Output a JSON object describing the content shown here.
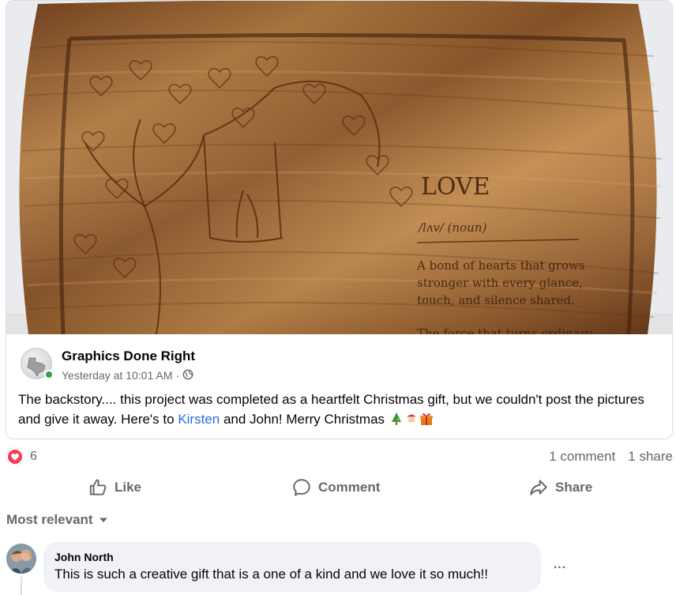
{
  "post": {
    "photo": {
      "board_text": {
        "title": "LOVE",
        "pronunciation": "/lʌv/ (noun)",
        "definition_lines": [
          "A bond of hearts that grows",
          "stronger with every glance,",
          "touch, and silence shared."
        ],
        "cut_off_line": "The force that turns ordinary"
      }
    },
    "author": {
      "name": "Graphics Done Right",
      "timestamp": "Yesterday at 10:01 AM",
      "separator": "·",
      "audience_icon": "globe-icon",
      "online": true
    },
    "text_before_mention": "The backstory.... this project was completed as a heartfelt Christmas gift, but we couldn't post the pictures and give it away. Here's to ",
    "mention": "Kirsten",
    "text_after_mention": " and John! Merry Christmas",
    "emojis": [
      "christmas-tree-icon",
      "santa-icon",
      "gift-icon"
    ]
  },
  "reactions": {
    "icon": "love-reaction-icon",
    "count": "6",
    "comments": "1 comment",
    "shares": "1 share"
  },
  "actions": {
    "like": "Like",
    "comment": "Comment",
    "share": "Share"
  },
  "comments": {
    "sort_label": "Most relevant",
    "items": [
      {
        "author": "John North",
        "text": "This is such a creative gift that is a one of a kind and we love it so much!!",
        "more": "..."
      }
    ]
  },
  "colors": {
    "link": "#216fdb",
    "secondary_text": "#65676b",
    "love": "#f33e58",
    "online": "#31a24c",
    "bubble": "#f0f2f5",
    "wood": "#a8703a"
  }
}
